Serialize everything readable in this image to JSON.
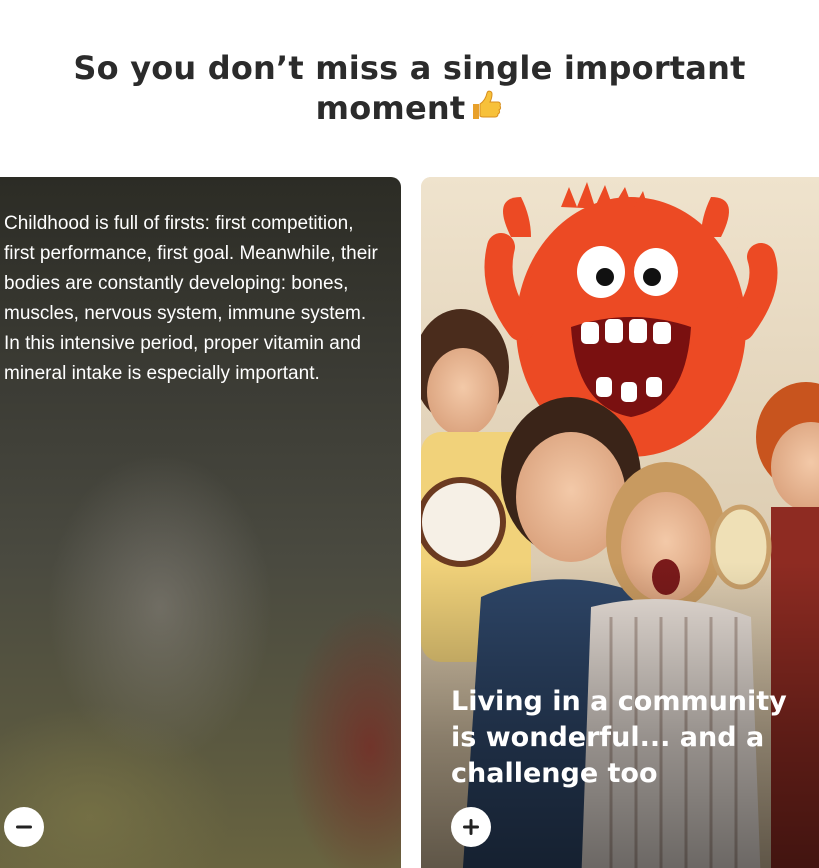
{
  "headline": {
    "line1": "So you don’t miss a single important",
    "line2": "moment",
    "emoji_icon": "thumbs-up-icon"
  },
  "cards": [
    {
      "state": "expanded",
      "body": "Childhood is full of firsts: first competition, first performance, first goal. Meanwhile, their bodies are constantly developing: bones, muscles, nervous system, immune system. In this intensive period, proper vitamin and mineral intake is especially important.",
      "toggle_icon": "minus-icon"
    },
    {
      "state": "collapsed",
      "title": "Living in a community is wonderful... and a challenge too",
      "toggle_icon": "plus-icon",
      "image": "photo-family-with-red-monster-toy"
    }
  ],
  "colors": {
    "headline": "#2b2b2b",
    "card_text": "#ffffff",
    "button_bg": "#ffffff",
    "icon": "#222222"
  }
}
